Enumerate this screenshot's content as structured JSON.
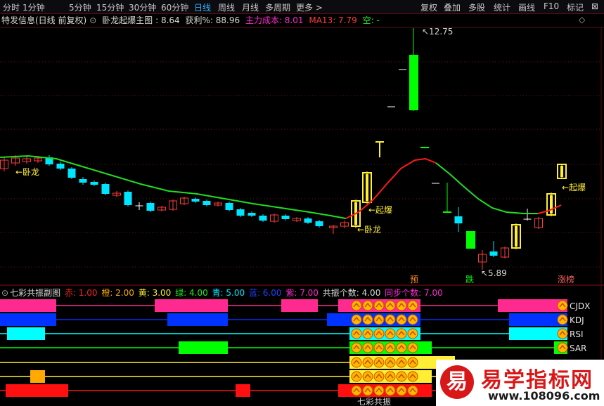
{
  "toolbar": {
    "periods": [
      "分时",
      "1分钟",
      "5分钟",
      "15分钟",
      "30分钟",
      "60分钟",
      "日线",
      "周线",
      "月线",
      "多周期",
      "更多 >"
    ],
    "active_period": "日线",
    "actions": [
      "复权",
      "叠加",
      "多股",
      "统计",
      "画线",
      "F10",
      "标记",
      "⊠"
    ]
  },
  "main_header": {
    "stock": "特发信息(日线 前复权)",
    "indicator_name": "卧龙起爆主图",
    "indicator_value": ": 8.64",
    "profit_label": "获利%: 88.96",
    "cost_label": "主力成本: 8.01",
    "ma_label": "MA13: 7.79",
    "empty_label": "空: -",
    "corner_glyph": "◇"
  },
  "main_chart_labels": {
    "high_value": "12.75",
    "low_value": "5.89",
    "wolong_1": "←卧龙",
    "wolong_2": "←卧龙",
    "qibao_1": "←起爆",
    "qibao_2": "←起爆",
    "marker_yu": "预",
    "marker_die": "跌",
    "marker_zhangting": "涨榜"
  },
  "sub_header": {
    "title": "七彩共振副图",
    "chi": "赤: 1.00",
    "cheng": "橙: 2.00",
    "huang": "黄: 3.00",
    "lv": "绿: 4.00",
    "qing": "青: 5.00",
    "lan": "蓝: 6.00",
    "zi": "紫: 7.00",
    "resonance_count": "共振个数: 4.00",
    "sync_count": "同步个数: 7.00"
  },
  "sub_rows": [
    "CJDX",
    "KDJ",
    "RSI",
    "SAR",
    "MACD",
    "",
    ""
  ],
  "sub_footer": {
    "center_label": "七彩共振",
    "right_label": "七彩共振"
  },
  "watermark": {
    "logo_char": "易",
    "title": "易学指标网",
    "url": "www.108096.com"
  },
  "colors": {
    "up": "#ff3b3b",
    "down": "#00e5ff",
    "ma": "#22dd22",
    "yellow": "#ffee33",
    "magenta": "#ff2a8f",
    "blue": "#0033ff",
    "cyan": "#00ffff",
    "green": "#00ff00",
    "red": "#ff1010",
    "orange": "#ffaa00"
  }
}
